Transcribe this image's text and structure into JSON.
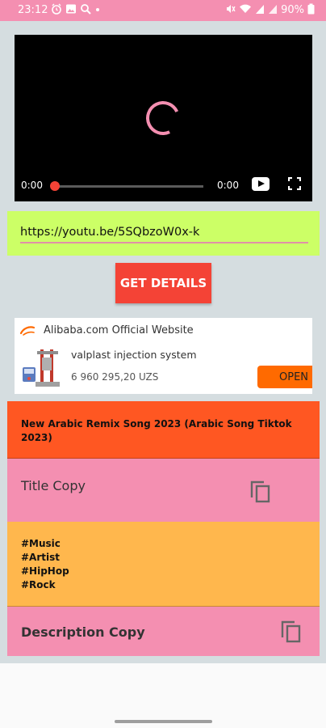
{
  "status_bar": {
    "time": "23:12",
    "battery": "90%",
    "left_icons": [
      "alarm-clock-icon",
      "image-icon",
      "search-icon",
      "dot-icon"
    ],
    "right_icons": [
      "mute-icon",
      "wifi-icon",
      "signal-icon",
      "signal-icon",
      "battery-icon"
    ]
  },
  "video": {
    "current_time": "0:00",
    "duration": "0:00",
    "progress": 0,
    "spinner_color": "#f48fb1",
    "scrub_color": "#f44336"
  },
  "url": {
    "value": "https://youtu.be/5SQbzoW0x-k"
  },
  "get_details_label": "GET DETAILS",
  "ad": {
    "title": "Alibaba.com Official Website",
    "product": "valplast injection system",
    "price": "6 960 295,20 UZS",
    "cta": "OPEN"
  },
  "video_title": "New Arabic Remix Song 2023 (Arabic Song Tiktok 2023)",
  "title_copy_label": "Title Copy",
  "tags": [
    "#Music",
    "#Artist",
    "#HipHop",
    "#Rock"
  ],
  "description_copy_label": "Description Copy",
  "colors": {
    "status_bar": "#f48fb1",
    "url_box": "#ccff66",
    "button": "#f44336",
    "title_bg": "#ff5722",
    "copy_bg": "#f48fb1",
    "tags_bg": "#ffb74d",
    "ad_cta": "#ff6a00"
  }
}
